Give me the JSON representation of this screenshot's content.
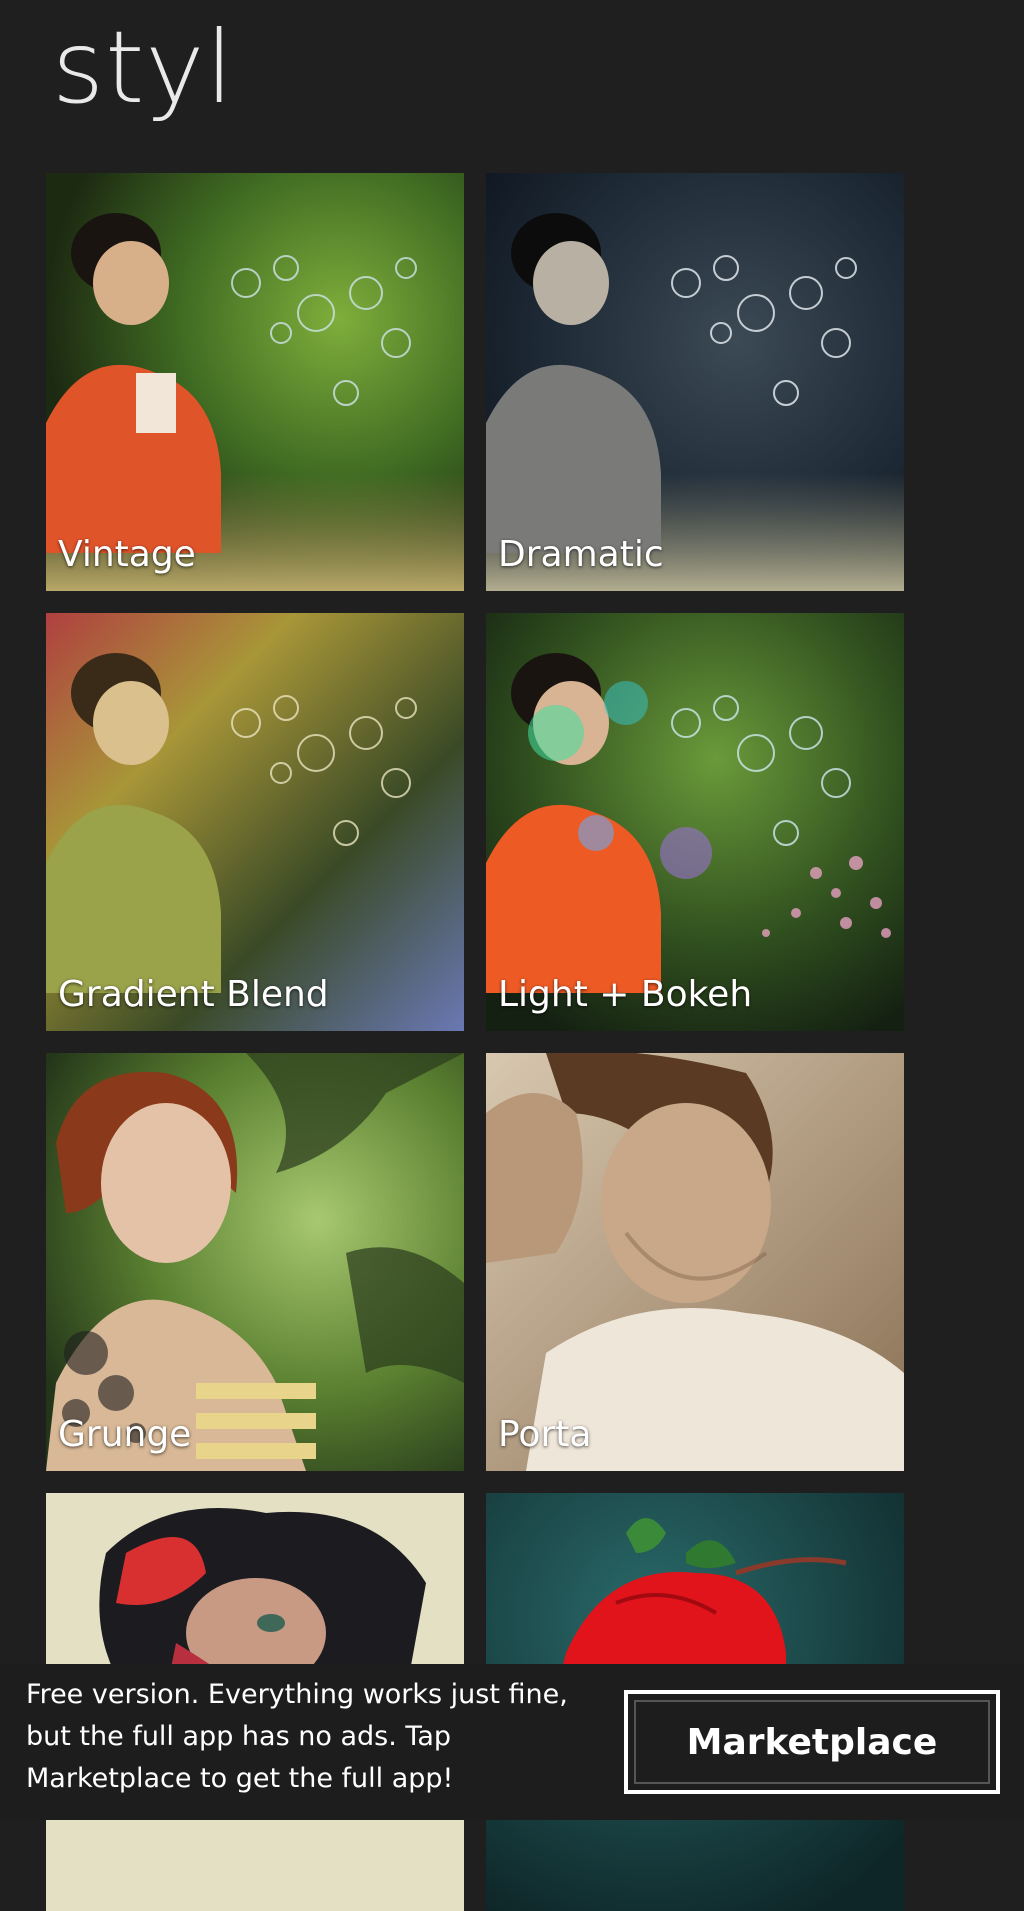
{
  "app": {
    "title": "styl"
  },
  "styles": [
    {
      "label": "Vintage"
    },
    {
      "label": "Dramatic"
    },
    {
      "label": "Gradient Blend"
    },
    {
      "label": "Light + Bokeh"
    },
    {
      "label": "Grunge"
    },
    {
      "label": "Porta"
    },
    {
      "label": ""
    },
    {
      "label": ""
    }
  ],
  "ad": {
    "message": "Free version. Everything works just fine, but the full app has no ads. Tap Marketplace to get the full app!",
    "button_label": "Marketplace"
  },
  "colors": {
    "background": "#1f1f1f",
    "text": "#ffffff"
  }
}
